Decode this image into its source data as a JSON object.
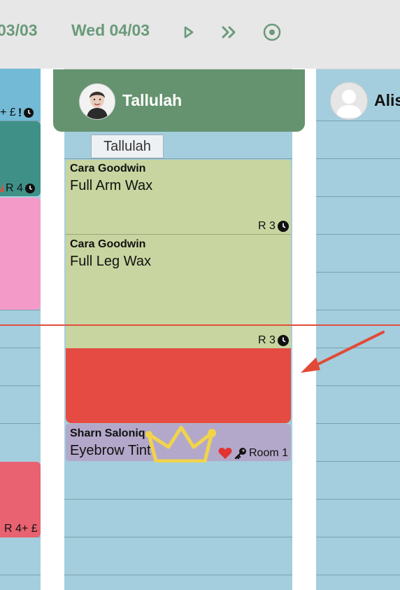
{
  "header": {
    "prev_date": "03/03",
    "current_date": "Wed 04/03"
  },
  "staff": [
    {
      "name": "Tallulah",
      "tooltip": "Tallulah"
    },
    {
      "name": "Alis"
    }
  ],
  "left_column": {
    "badge_top": "+ £",
    "badge_room": "R 4",
    "badge_bottom": "R 4+ £"
  },
  "appointments": [
    {
      "client": "Cara Goodwin",
      "service": "Full Arm Wax",
      "room": "R 3"
    },
    {
      "client": "Cara Goodwin",
      "service": "Full Leg Wax",
      "room": "R 3"
    },
    {
      "client": "Sharn Saloniq",
      "service": "Eyebrow Tint",
      "room": "Room 1"
    }
  ],
  "colors": {
    "accent_green": "#65936f",
    "slot_blue": "#a4cedd",
    "appt_green": "#c8d5a0",
    "appt_red": "#e54b43",
    "appt_purple": "#b3a8ca",
    "left_teal": "#3f9188",
    "left_pink": "#f49ac9",
    "left_rose": "#e86271",
    "now_line": "#e24e3f"
  }
}
